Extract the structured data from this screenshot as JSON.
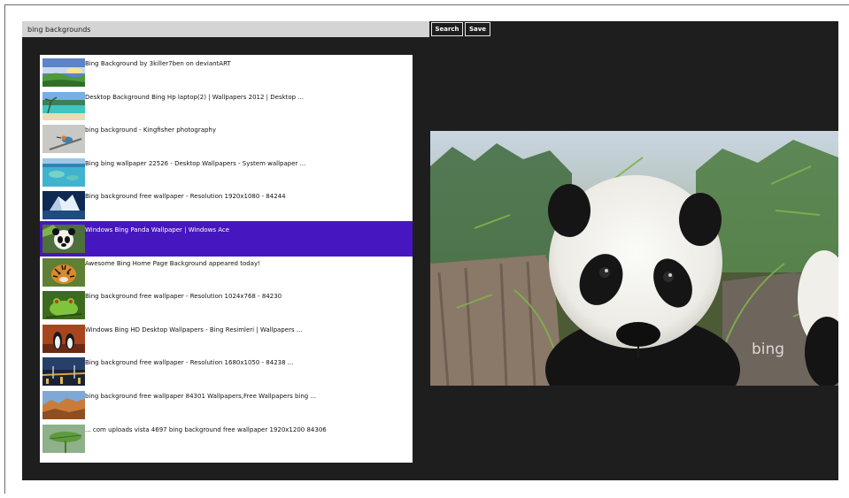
{
  "search": {
    "value": "bing backgrounds",
    "search_label": "Search",
    "save_label": "Save"
  },
  "results": [
    {
      "title": "Bing Background by 3killer7ben on deviantART",
      "thumb": "sunset-hills"
    },
    {
      "title": "Desktop Background Bing Hp laptop(2) | Wallpapers 2012 | Desktop ...",
      "thumb": "tropical-beach"
    },
    {
      "title": "bing background - Kingfisher photography",
      "thumb": "kingfisher"
    },
    {
      "title": "Bing bing wallpaper 22526 - Desktop Wallpapers - System wallpaper ...",
      "thumb": "lagoon"
    },
    {
      "title": "Bing background free wallpaper - Resolution 1920x1080 - 84244",
      "thumb": "iceberg"
    },
    {
      "title": "Windows Bing Panda Wallpaper | Windows Ace",
      "thumb": "panda",
      "selected": true
    },
    {
      "title": "Awesome Bing Home Page Background appeared today!",
      "thumb": "tiger"
    },
    {
      "title": "Bing background free wallpaper - Resolution 1024x768 - 84230",
      "thumb": "frog"
    },
    {
      "title": "Windows Bing HD Desktop Wallpapers - Bing Resimleri | Wallpapers ...",
      "thumb": "penguins"
    },
    {
      "title": "Bing background free wallpaper - Resolution 1680x1050 - 84238 ...",
      "thumb": "city-bridge"
    },
    {
      "title": "bing background free wallpaper 84301 Wallpapers,Free Wallpapers bing ...",
      "thumb": "desert-cliffs"
    },
    {
      "title": "... com uploads vista 4697 bing background free wallpaper 1920x1200 84306",
      "thumb": "leaf-macro"
    }
  ],
  "preview": {
    "watermark": "bing"
  }
}
